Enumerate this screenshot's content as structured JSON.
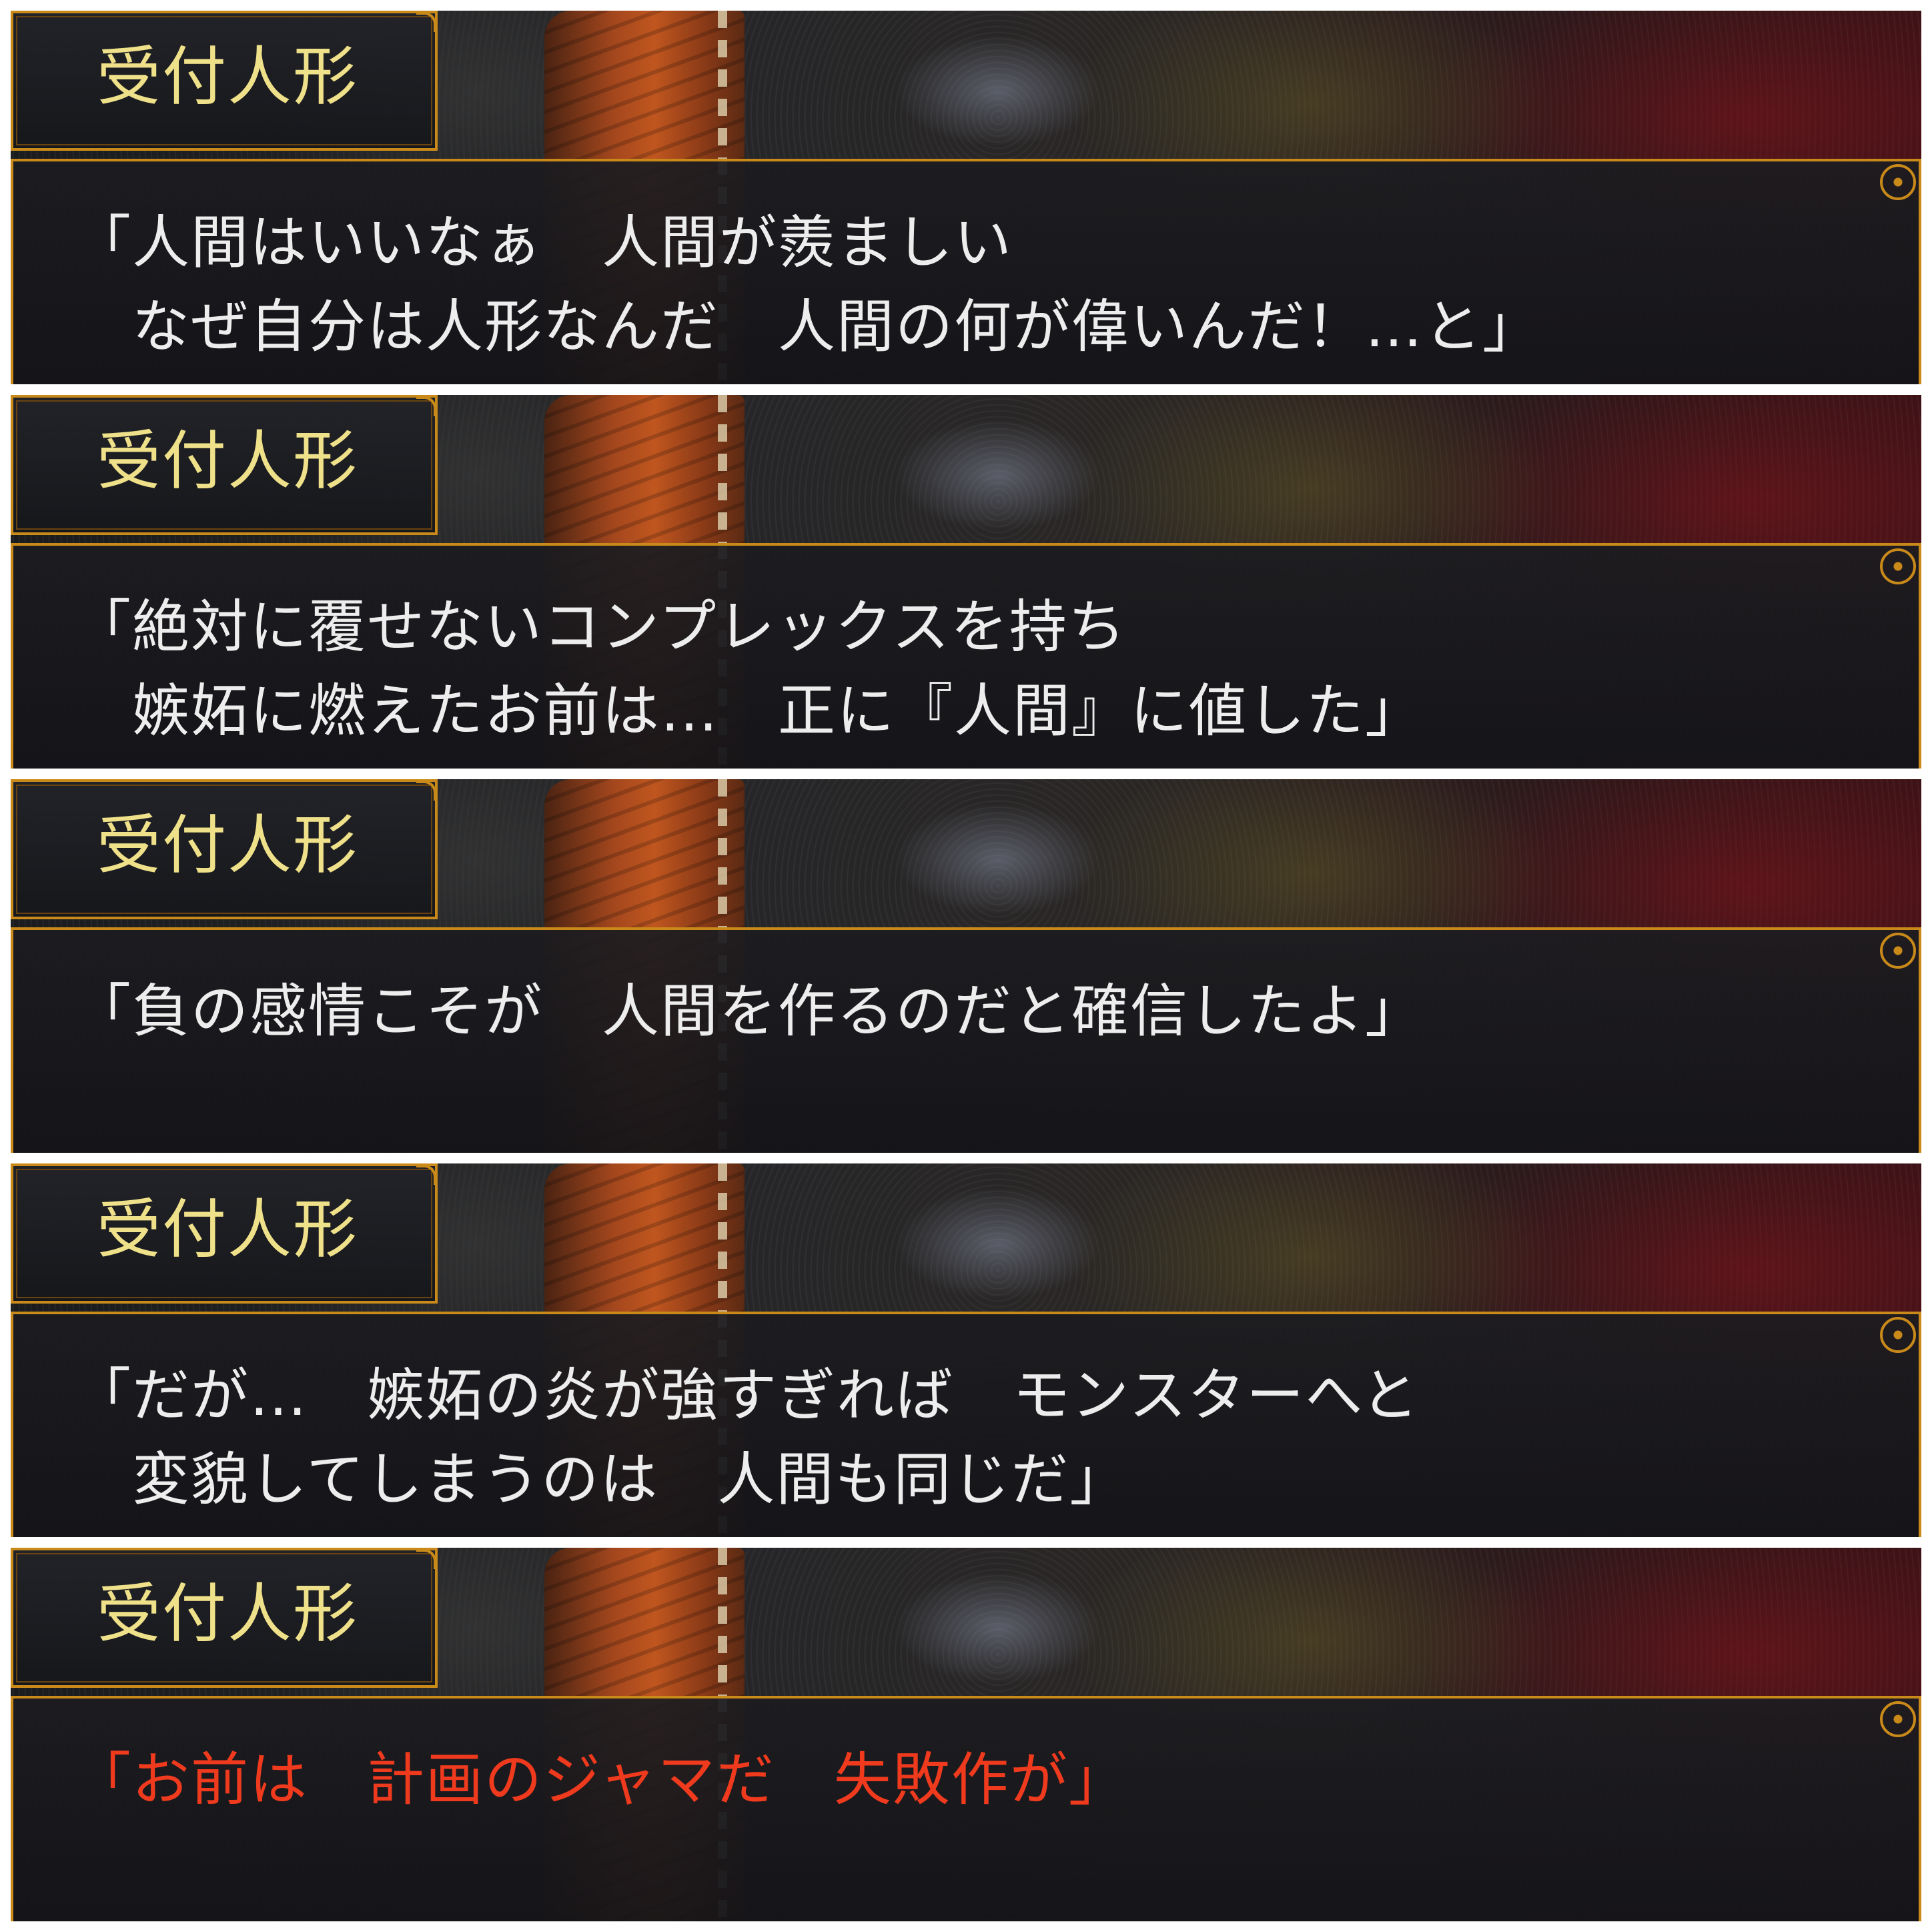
{
  "colors": {
    "frame": "#c98a1a",
    "speaker_name": "#efe08a",
    "dialogue": "#ededed",
    "dialogue_emphasis": "#ef3a1e"
  },
  "panels": [
    {
      "speaker": "受付人形",
      "lines": [
        "「人間はいいなぁ　人間が羨ましい",
        "　なぜ自分は人形なんだ　人間の何が偉いんだ！…と」"
      ],
      "highlight": false
    },
    {
      "speaker": "受付人形",
      "lines": [
        "「絶対に覆せないコンプレックスを持ち",
        "　嫉妬に燃えたお前は…　正に『人間』に値した」"
      ],
      "highlight": false
    },
    {
      "speaker": "受付人形",
      "lines": [
        "「負の感情こそが　人間を作るのだと確信したよ」",
        ""
      ],
      "highlight": false
    },
    {
      "speaker": "受付人形",
      "lines": [
        "「だが…　嫉妬の炎が強すぎれば　モンスターへと",
        "　変貌してしまうのは　人間も同じだ」"
      ],
      "highlight": false
    },
    {
      "speaker": "受付人形",
      "lines": [
        "「お前は　計画のジャマだ　失敗作が」",
        ""
      ],
      "highlight": true
    }
  ]
}
